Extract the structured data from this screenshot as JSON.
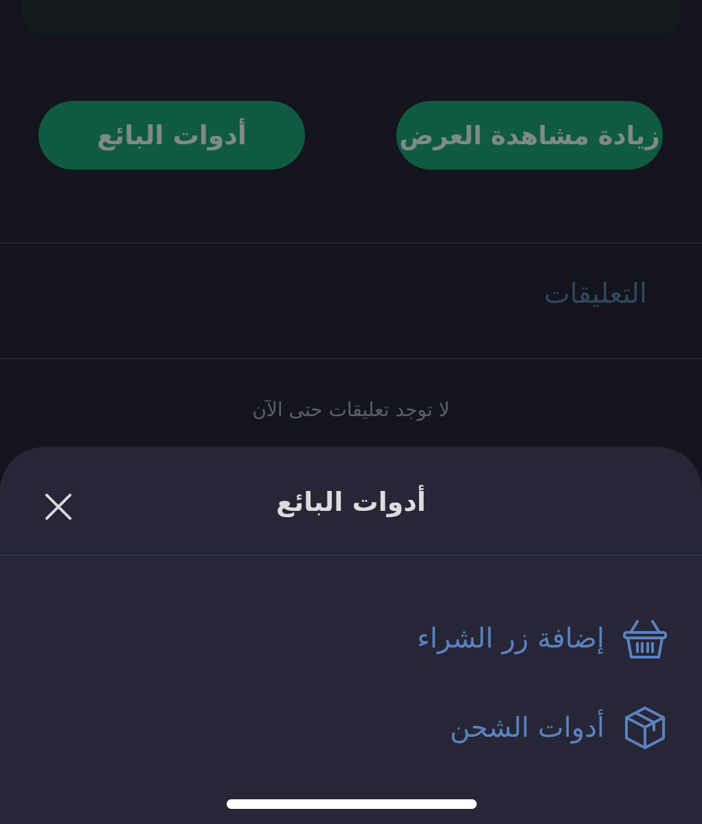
{
  "colors": {
    "background": "#13141d",
    "sheet_background": "#262636",
    "green_button": "#105a40",
    "accent_blue": "#5b82c0"
  },
  "actions": {
    "boost_label": "زيادة مشاهدة العرض",
    "seller_tools_label": "أدوات البائع"
  },
  "comments": {
    "title": "التعليقات",
    "empty_text": "لا توجد تعليقات حتى الآن"
  },
  "sheet": {
    "title": "أدوات البائع",
    "close_icon": "close-icon",
    "items": [
      {
        "label": "إضافة زر الشراء",
        "icon": "basket-icon"
      },
      {
        "label": "أدوات الشحن",
        "icon": "box-icon"
      }
    ]
  }
}
